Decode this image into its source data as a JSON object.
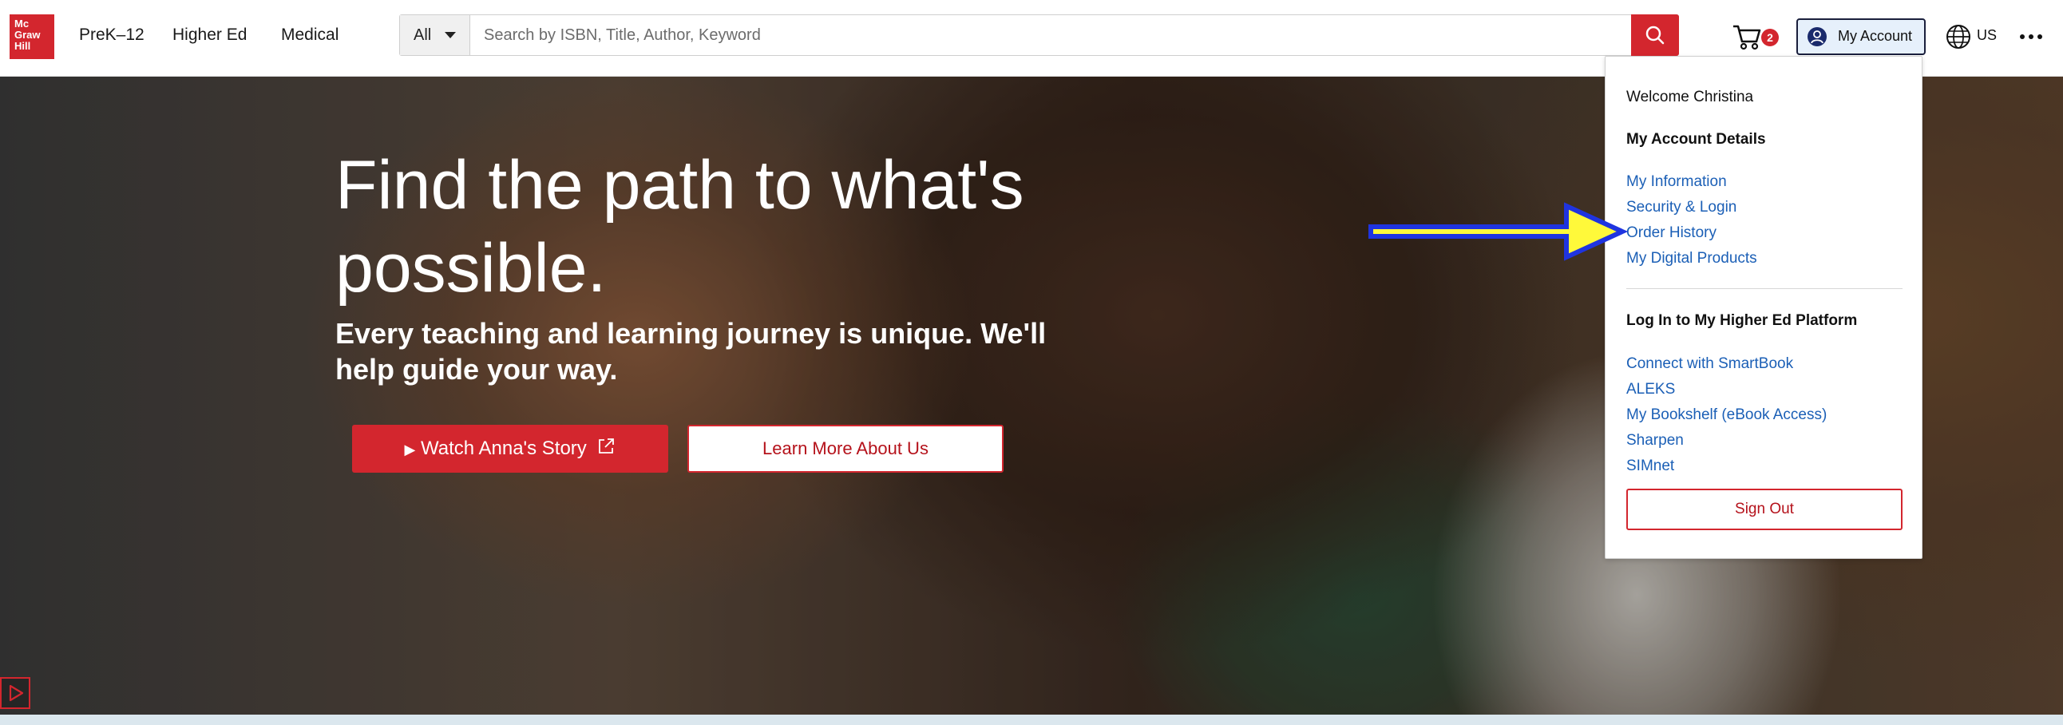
{
  "brand": {
    "logo_lines": [
      "Mc",
      "Graw",
      "Hill"
    ],
    "red": "#d3262e",
    "link_blue": "#1b5fb6"
  },
  "nav": {
    "items": [
      {
        "label": "PreK–12"
      },
      {
        "label": "Higher Ed"
      },
      {
        "label": "Medical"
      }
    ]
  },
  "search": {
    "category": "All",
    "placeholder": "Search by ISBN, Title, Author, Keyword",
    "value": ""
  },
  "cart": {
    "count": "2"
  },
  "account": {
    "button_label": "My Account"
  },
  "region": {
    "label": "US"
  },
  "dropdown": {
    "welcome": "Welcome Christina",
    "details_heading": "My Account Details",
    "details_links": [
      {
        "label": "My Information"
      },
      {
        "label": "Security & Login"
      },
      {
        "label": "Order History"
      },
      {
        "label": "My Digital Products"
      }
    ],
    "platform_heading": "Log In to My Higher Ed Platform",
    "platform_links": [
      {
        "label": "Connect with SmartBook"
      },
      {
        "label": "ALEKS"
      },
      {
        "label": "My Bookshelf (eBook Access)"
      },
      {
        "label": "Sharpen"
      },
      {
        "label": "SIMnet"
      }
    ],
    "sign_out": "Sign Out"
  },
  "hero": {
    "headline": "Find the path to what's possible.",
    "subhead": "Every teaching and learning journey is unique. We'll help guide your way.",
    "watch_label": "Watch Anna's Story",
    "learn_label": "Learn More About Us"
  },
  "annotation": {
    "arrow_fill": "#fff93a",
    "arrow_stroke": "#1f34e0",
    "points_to": "Order History"
  }
}
